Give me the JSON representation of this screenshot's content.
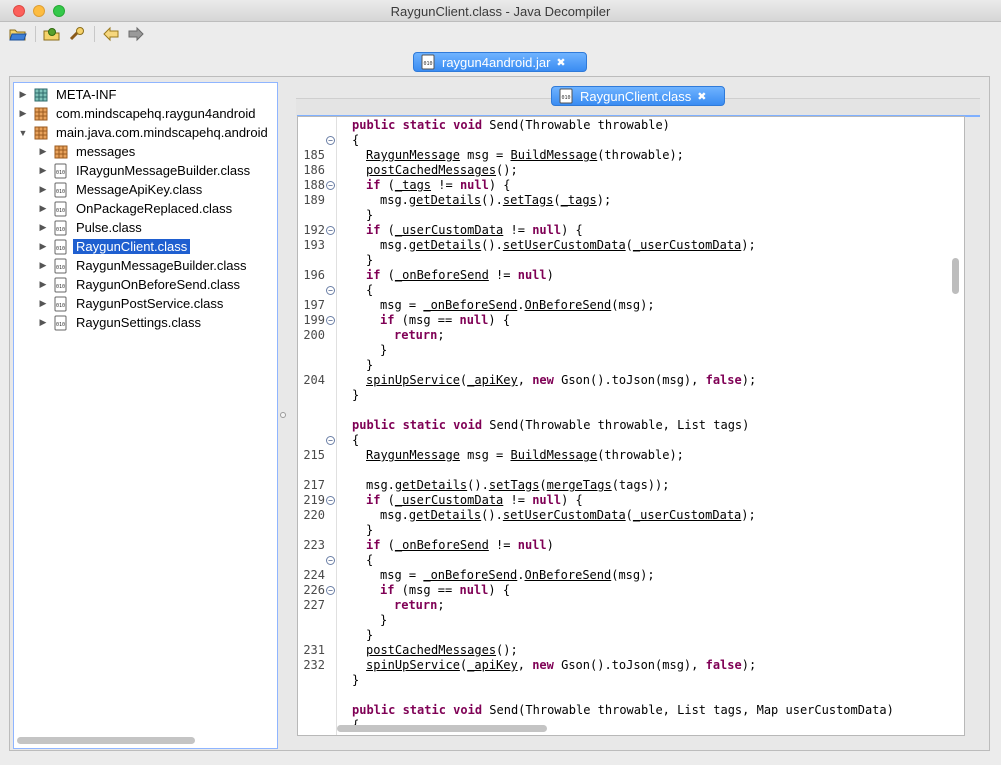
{
  "window": {
    "title": "RaygunClient.class - Java Decompiler"
  },
  "toolbar": {
    "icons": [
      "open-folder-icon",
      "open-archive-icon",
      "search-icon",
      "back-arrow-icon",
      "forward-arrow-icon"
    ]
  },
  "jar_tab": {
    "label": "raygun4android.jar",
    "close": "✖"
  },
  "class_tab": {
    "label": "RaygunClient.class",
    "close": "✖"
  },
  "tree": {
    "items": [
      {
        "label": "META-INF",
        "expanded": false,
        "indent": 0,
        "icon": "package-icon"
      },
      {
        "label": "com.mindscapehq.raygun4android",
        "expanded": false,
        "indent": 0,
        "icon": "package-icon"
      },
      {
        "label": "main.java.com.mindscapehq.android",
        "expanded": true,
        "indent": 0,
        "icon": "package-icon"
      },
      {
        "label": "messages",
        "expanded": false,
        "indent": 1,
        "icon": "package-icon"
      },
      {
        "label": "IRaygunMessageBuilder.class",
        "expanded": false,
        "indent": 1,
        "icon": "class-file-icon"
      },
      {
        "label": "MessageApiKey.class",
        "expanded": false,
        "indent": 1,
        "icon": "class-file-icon"
      },
      {
        "label": "OnPackageReplaced.class",
        "expanded": false,
        "indent": 1,
        "icon": "class-file-icon"
      },
      {
        "label": "Pulse.class",
        "expanded": false,
        "indent": 1,
        "icon": "class-file-icon"
      },
      {
        "label": "RaygunClient.class",
        "expanded": false,
        "indent": 1,
        "icon": "class-file-icon",
        "selected": true
      },
      {
        "label": "RaygunMessageBuilder.class",
        "expanded": false,
        "indent": 1,
        "icon": "class-file-icon"
      },
      {
        "label": "RaygunOnBeforeSend.class",
        "expanded": false,
        "indent": 1,
        "icon": "class-file-icon"
      },
      {
        "label": "RaygunPostService.class",
        "expanded": false,
        "indent": 1,
        "icon": "class-file-icon"
      },
      {
        "label": "RaygunSettings.class",
        "expanded": false,
        "indent": 1,
        "icon": "class-file-icon"
      }
    ]
  },
  "code": {
    "lines": [
      {
        "ln": "",
        "fold": false,
        "t": [
          [
            "k",
            "public static void "
          ],
          [
            "",
            "Send(Throwable throwable)"
          ]
        ],
        "indent": 0
      },
      {
        "ln": "",
        "fold": true,
        "t": [
          [
            "",
            "{"
          ]
        ],
        "indent": 0
      },
      {
        "ln": "185",
        "fold": false,
        "t": [
          [
            "u",
            "RaygunMessage"
          ],
          [
            "",
            " msg = "
          ],
          [
            "u",
            "BuildMessage"
          ],
          [
            "",
            "(throwable);"
          ]
        ],
        "indent": 1
      },
      {
        "ln": "186",
        "fold": false,
        "t": [
          [
            "u",
            "postCachedMessages"
          ],
          [
            "",
            "();"
          ]
        ],
        "indent": 1
      },
      {
        "ln": "188",
        "fold": true,
        "t": [
          [
            "k",
            "if"
          ],
          [
            "",
            " ("
          ],
          [
            "u",
            "_tags"
          ],
          [
            "",
            " != "
          ],
          [
            "k",
            "null"
          ],
          [
            "",
            ") {"
          ]
        ],
        "indent": 1
      },
      {
        "ln": "189",
        "fold": false,
        "t": [
          [
            "",
            "msg."
          ],
          [
            "u",
            "getDetails"
          ],
          [
            "",
            "()."
          ],
          [
            "u",
            "setTags"
          ],
          [
            "",
            "("
          ],
          [
            "u",
            "_tags"
          ],
          [
            "",
            ");"
          ]
        ],
        "indent": 2
      },
      {
        "ln": "",
        "fold": false,
        "t": [
          [
            "",
            "}"
          ]
        ],
        "indent": 1
      },
      {
        "ln": "192",
        "fold": true,
        "t": [
          [
            "k",
            "if"
          ],
          [
            "",
            " ("
          ],
          [
            "u",
            "_userCustomData"
          ],
          [
            "",
            " != "
          ],
          [
            "k",
            "null"
          ],
          [
            "",
            ") {"
          ]
        ],
        "indent": 1
      },
      {
        "ln": "193",
        "fold": false,
        "t": [
          [
            "",
            "msg."
          ],
          [
            "u",
            "getDetails"
          ],
          [
            "",
            "()."
          ],
          [
            "u",
            "setUserCustomData"
          ],
          [
            "",
            "("
          ],
          [
            "u",
            "_userCustomData"
          ],
          [
            "",
            ");"
          ]
        ],
        "indent": 2
      },
      {
        "ln": "",
        "fold": false,
        "t": [
          [
            "",
            "}"
          ]
        ],
        "indent": 1
      },
      {
        "ln": "196",
        "fold": false,
        "t": [
          [
            "k",
            "if"
          ],
          [
            "",
            " ("
          ],
          [
            "u",
            "_onBeforeSend"
          ],
          [
            "",
            " != "
          ],
          [
            "k",
            "null"
          ],
          [
            "",
            ")"
          ]
        ],
        "indent": 1
      },
      {
        "ln": "",
        "fold": true,
        "t": [
          [
            "",
            "{"
          ]
        ],
        "indent": 1
      },
      {
        "ln": "197",
        "fold": false,
        "t": [
          [
            "",
            "msg = "
          ],
          [
            "u",
            "_onBeforeSend"
          ],
          [
            "",
            "."
          ],
          [
            "u",
            "OnBeforeSend"
          ],
          [
            "",
            "(msg);"
          ]
        ],
        "indent": 2
      },
      {
        "ln": "199",
        "fold": true,
        "t": [
          [
            "k",
            "if"
          ],
          [
            "",
            " (msg == "
          ],
          [
            "k",
            "null"
          ],
          [
            "",
            ") {"
          ]
        ],
        "indent": 2
      },
      {
        "ln": "200",
        "fold": false,
        "t": [
          [
            "k",
            "return"
          ],
          [
            "",
            ";"
          ]
        ],
        "indent": 3
      },
      {
        "ln": "",
        "fold": false,
        "t": [
          [
            "",
            "}"
          ]
        ],
        "indent": 2
      },
      {
        "ln": "",
        "fold": false,
        "t": [
          [
            "",
            "}"
          ]
        ],
        "indent": 1
      },
      {
        "ln": "204",
        "fold": false,
        "t": [
          [
            "u",
            "spinUpService"
          ],
          [
            "",
            "("
          ],
          [
            "u",
            "_apiKey"
          ],
          [
            "",
            ", "
          ],
          [
            "k",
            "new"
          ],
          [
            "",
            " Gson().toJson(msg), "
          ],
          [
            "k",
            "false"
          ],
          [
            "",
            ");"
          ]
        ],
        "indent": 1
      },
      {
        "ln": "",
        "fold": false,
        "t": [
          [
            "",
            "}"
          ]
        ],
        "indent": 0
      },
      {
        "ln": "",
        "fold": false,
        "t": [],
        "indent": 0
      },
      {
        "ln": "",
        "fold": false,
        "t": [
          [
            "k",
            "public static void "
          ],
          [
            "",
            "Send(Throwable throwable, List tags)"
          ]
        ],
        "indent": 0
      },
      {
        "ln": "",
        "fold": true,
        "t": [
          [
            "",
            "{"
          ]
        ],
        "indent": 0
      },
      {
        "ln": "215",
        "fold": false,
        "t": [
          [
            "u",
            "RaygunMessage"
          ],
          [
            "",
            " msg = "
          ],
          [
            "u",
            "BuildMessage"
          ],
          [
            "",
            "(throwable);"
          ]
        ],
        "indent": 1
      },
      {
        "ln": "",
        "fold": false,
        "t": [],
        "indent": 0
      },
      {
        "ln": "217",
        "fold": false,
        "t": [
          [
            "",
            "msg."
          ],
          [
            "u",
            "getDetails"
          ],
          [
            "",
            "()."
          ],
          [
            "u",
            "setTags"
          ],
          [
            "",
            "("
          ],
          [
            "u",
            "mergeTags"
          ],
          [
            "",
            "(tags));"
          ]
        ],
        "indent": 1
      },
      {
        "ln": "219",
        "fold": true,
        "t": [
          [
            "k",
            "if"
          ],
          [
            "",
            " ("
          ],
          [
            "u",
            "_userCustomData"
          ],
          [
            "",
            " != "
          ],
          [
            "k",
            "null"
          ],
          [
            "",
            ") {"
          ]
        ],
        "indent": 1
      },
      {
        "ln": "220",
        "fold": false,
        "t": [
          [
            "",
            "msg."
          ],
          [
            "u",
            "getDetails"
          ],
          [
            "",
            "()."
          ],
          [
            "u",
            "setUserCustomData"
          ],
          [
            "",
            "("
          ],
          [
            "u",
            "_userCustomData"
          ],
          [
            "",
            ");"
          ]
        ],
        "indent": 2
      },
      {
        "ln": "",
        "fold": false,
        "t": [
          [
            "",
            "}"
          ]
        ],
        "indent": 1
      },
      {
        "ln": "223",
        "fold": false,
        "t": [
          [
            "k",
            "if"
          ],
          [
            "",
            " ("
          ],
          [
            "u",
            "_onBeforeSend"
          ],
          [
            "",
            " != "
          ],
          [
            "k",
            "null"
          ],
          [
            "",
            ")"
          ]
        ],
        "indent": 1
      },
      {
        "ln": "",
        "fold": true,
        "t": [
          [
            "",
            "{"
          ]
        ],
        "indent": 1
      },
      {
        "ln": "224",
        "fold": false,
        "t": [
          [
            "",
            "msg = "
          ],
          [
            "u",
            "_onBeforeSend"
          ],
          [
            "",
            "."
          ],
          [
            "u",
            "OnBeforeSend"
          ],
          [
            "",
            "(msg);"
          ]
        ],
        "indent": 2
      },
      {
        "ln": "226",
        "fold": true,
        "t": [
          [
            "k",
            "if"
          ],
          [
            "",
            " (msg == "
          ],
          [
            "k",
            "null"
          ],
          [
            "",
            ") {"
          ]
        ],
        "indent": 2
      },
      {
        "ln": "227",
        "fold": false,
        "t": [
          [
            "k",
            "return"
          ],
          [
            "",
            ";"
          ]
        ],
        "indent": 3
      },
      {
        "ln": "",
        "fold": false,
        "t": [
          [
            "",
            "}"
          ]
        ],
        "indent": 2
      },
      {
        "ln": "",
        "fold": false,
        "t": [
          [
            "",
            "}"
          ]
        ],
        "indent": 1
      },
      {
        "ln": "231",
        "fold": false,
        "t": [
          [
            "u",
            "postCachedMessages"
          ],
          [
            "",
            "();"
          ]
        ],
        "indent": 1
      },
      {
        "ln": "232",
        "fold": false,
        "t": [
          [
            "u",
            "spinUpService"
          ],
          [
            "",
            "("
          ],
          [
            "u",
            "_apiKey"
          ],
          [
            "",
            ", "
          ],
          [
            "k",
            "new"
          ],
          [
            "",
            " Gson().toJson(msg), "
          ],
          [
            "k",
            "false"
          ],
          [
            "",
            ");"
          ]
        ],
        "indent": 1
      },
      {
        "ln": "",
        "fold": false,
        "t": [
          [
            "",
            "}"
          ]
        ],
        "indent": 0
      },
      {
        "ln": "",
        "fold": false,
        "t": [],
        "indent": 0
      },
      {
        "ln": "",
        "fold": false,
        "t": [
          [
            "k",
            "public static void "
          ],
          [
            "",
            "Send(Throwable throwable, List tags, Map userCustomData)"
          ]
        ],
        "indent": 0
      },
      {
        "ln": "",
        "fold": false,
        "t": [
          [
            "",
            "{"
          ]
        ],
        "indent": 0
      }
    ]
  }
}
